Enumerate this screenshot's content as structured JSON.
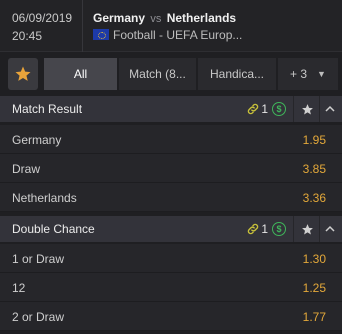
{
  "match": {
    "date": "06/09/2019",
    "time": "20:45",
    "home": "Germany",
    "vs": "vs",
    "away": "Netherlands",
    "competition": "Football - UEFA Europ..."
  },
  "tabs": {
    "favorites_icon": "star-icon",
    "items": [
      "All",
      "Match (8...",
      "Handica...",
      "+ 3"
    ],
    "active": "All"
  },
  "markets": [
    {
      "title": "Match Result",
      "link_count": "1",
      "selections": [
        {
          "name": "Germany",
          "odds": "1.95"
        },
        {
          "name": "Draw",
          "odds": "3.85"
        },
        {
          "name": "Netherlands",
          "odds": "3.36"
        }
      ]
    },
    {
      "title": "Double Chance",
      "link_count": "1",
      "selections": [
        {
          "name": "1 or Draw",
          "odds": "1.30"
        },
        {
          "name": "12",
          "odds": "1.25"
        },
        {
          "name": "2 or Draw",
          "odds": "1.77"
        }
      ]
    }
  ],
  "colors": {
    "odds": "#e3a83a",
    "favorite_star": "#e8a33a",
    "cashout": "#3fb55a",
    "link": "#c7c03a"
  }
}
